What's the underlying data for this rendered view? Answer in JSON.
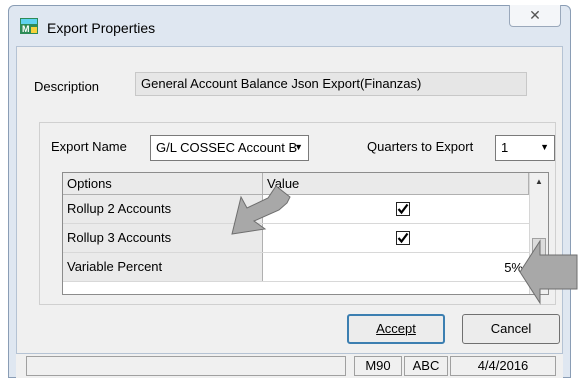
{
  "window": {
    "title": "Export Properties",
    "close_label": "✕"
  },
  "description": {
    "label": "Description",
    "value": "General Account Balance Json Export(Finanzas)"
  },
  "export_name": {
    "label": "Export Name",
    "value": "G/L COSSEC Account B"
  },
  "quarters": {
    "label": "Quarters to Export",
    "value": "1"
  },
  "grid": {
    "columns": [
      "Options",
      "Value"
    ],
    "rows": [
      {
        "name": "Rollup 2 Accounts",
        "checked": true
      },
      {
        "name": "Rollup 3 Accounts",
        "checked": true
      },
      {
        "name": "Variable Percent",
        "value": "5%"
      }
    ]
  },
  "buttons": {
    "accept": "Accept",
    "cancel": "Cancel"
  },
  "status": {
    "panel1": "",
    "panel2": "M90",
    "panel3": "ABC",
    "panel4": "4/4/2016"
  },
  "colors": {
    "window_frame": "#dfe7f1",
    "annotation_arrow": "#a8a8a8",
    "accept_focus": "#3c7fb1"
  }
}
